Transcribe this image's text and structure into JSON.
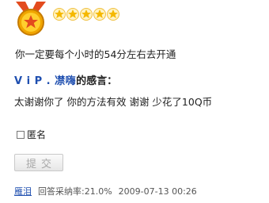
{
  "rating": {
    "stars": 5,
    "star_color": "#f5b800",
    "medal_color": "#e34b1e"
  },
  "answer": {
    "text": "你一定要每个小时的54分左右去开通"
  },
  "thanks": {
    "user": "V i P .  凚嗨",
    "suffix": "的感言：",
    "text": "太谢谢你了  你的方法有效  谢谢  少花了10Q币"
  },
  "form": {
    "anonymous_label": "匿名",
    "submit_label": "提交"
  },
  "footer": {
    "author": "雁泪",
    "rate_label": "回答采纳率:21.0%",
    "timestamp": "2009-07-13 00:26"
  }
}
